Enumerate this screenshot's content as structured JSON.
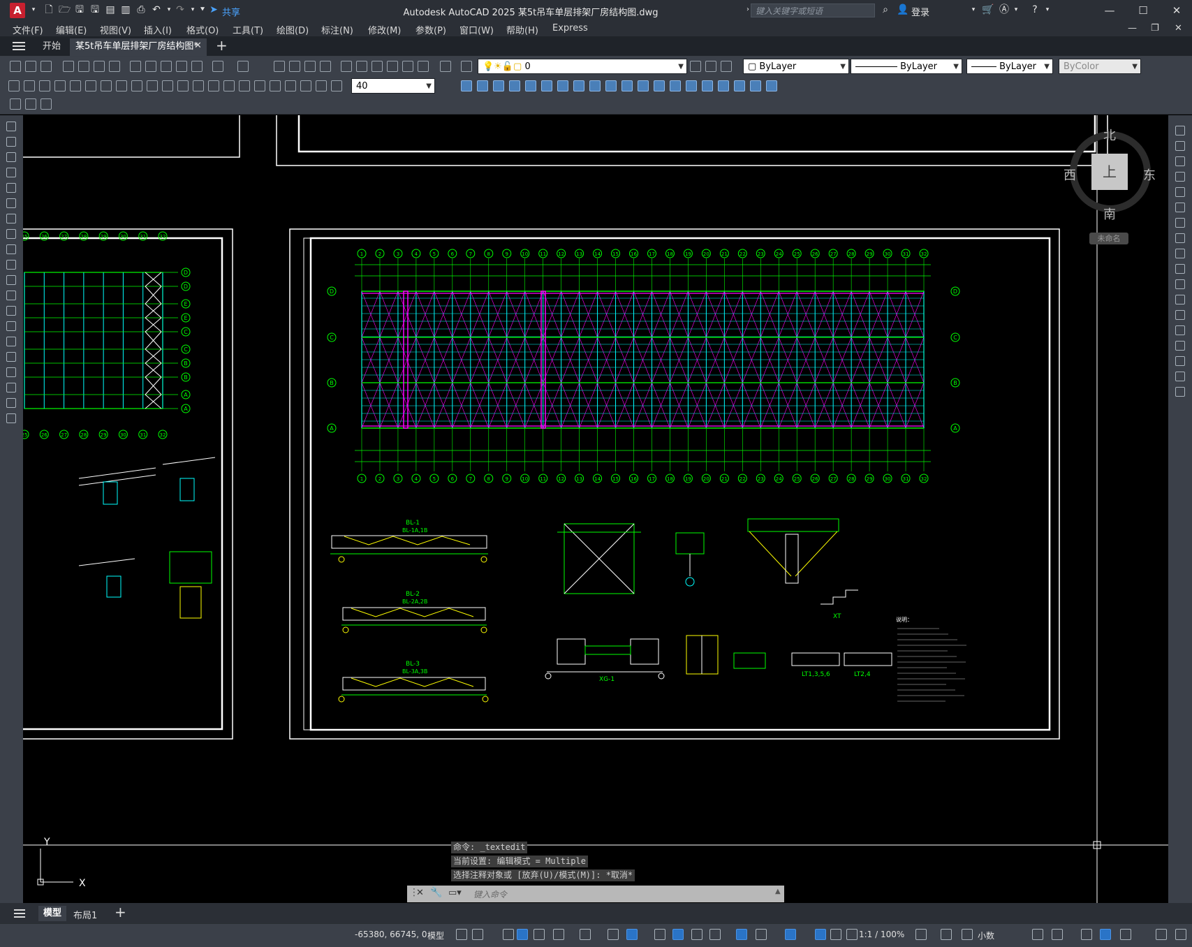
{
  "app": {
    "logo_letter": "A",
    "share_label": "共享",
    "title": "Autodesk AutoCAD 2025    某5t吊车单层排架厂房结构图.dwg",
    "search_placeholder": "键入关键字或短语",
    "login_label": "登录"
  },
  "menu": [
    "文件(F)",
    "编辑(E)",
    "视图(V)",
    "插入(I)",
    "格式(O)",
    "工具(T)",
    "绘图(D)",
    "标注(N)",
    "修改(M)",
    "参数(P)",
    "窗口(W)",
    "帮助(H)",
    "Express"
  ],
  "tabs": {
    "start_label": "开始",
    "doc_label": "某5t吊车单层排架厂房结构图*"
  },
  "toolbar": {
    "layer_value": "0",
    "color_value": "ByLayer",
    "linetype_value": "ByLayer",
    "lineweight_value": "ByLayer",
    "plotstyle_value": "ByColor",
    "textheight_value": "40"
  },
  "viewcube": {
    "north": "北",
    "south": "南",
    "east": "东",
    "west": "西",
    "face": "上",
    "ucs_label": "未命名"
  },
  "drawing": {
    "axis_numbers": [
      "1",
      "2",
      "3",
      "4",
      "5",
      "6",
      "7",
      "8",
      "9",
      "10",
      "11",
      "12",
      "13",
      "14",
      "15",
      "16",
      "17",
      "18",
      "19",
      "20",
      "21",
      "22",
      "23",
      "24",
      "25",
      "26",
      "27",
      "28",
      "29",
      "30",
      "31",
      "32"
    ],
    "row_letters": [
      "D",
      "C",
      "B",
      "A"
    ],
    "left_row_letters": [
      "D",
      "E",
      "C",
      "B",
      "A"
    ],
    "left_cols": [
      "25",
      "26",
      "27",
      "28",
      "29",
      "30",
      "31",
      "32"
    ],
    "beam_labels": [
      {
        "main": "BL-1",
        "sub": "BL-1A,1B"
      },
      {
        "main": "BL-2",
        "sub": "BL-2A,2B"
      },
      {
        "main": "BL-3",
        "sub": "BL-3A,3B"
      }
    ],
    "detail_labels": [
      "XG-1",
      "XT",
      "LT1,3,5,6",
      "LT2,4"
    ],
    "notes_title": "说明："
  },
  "ucs": {
    "y": "Y",
    "x": "X"
  },
  "command": {
    "lines": [
      "命令: _textedit",
      "当前设置: 编辑模式 = Multiple",
      "选择注释对象或 [放弃(U)/模式(M)]: *取消*"
    ],
    "placeholder": "键入命令"
  },
  "layouts": {
    "model": "模型",
    "layout1": "布局1"
  },
  "status": {
    "coords": "-65380, 66745, 0",
    "space": "模型",
    "scale": "1:1 / 100%",
    "units": "小数"
  }
}
